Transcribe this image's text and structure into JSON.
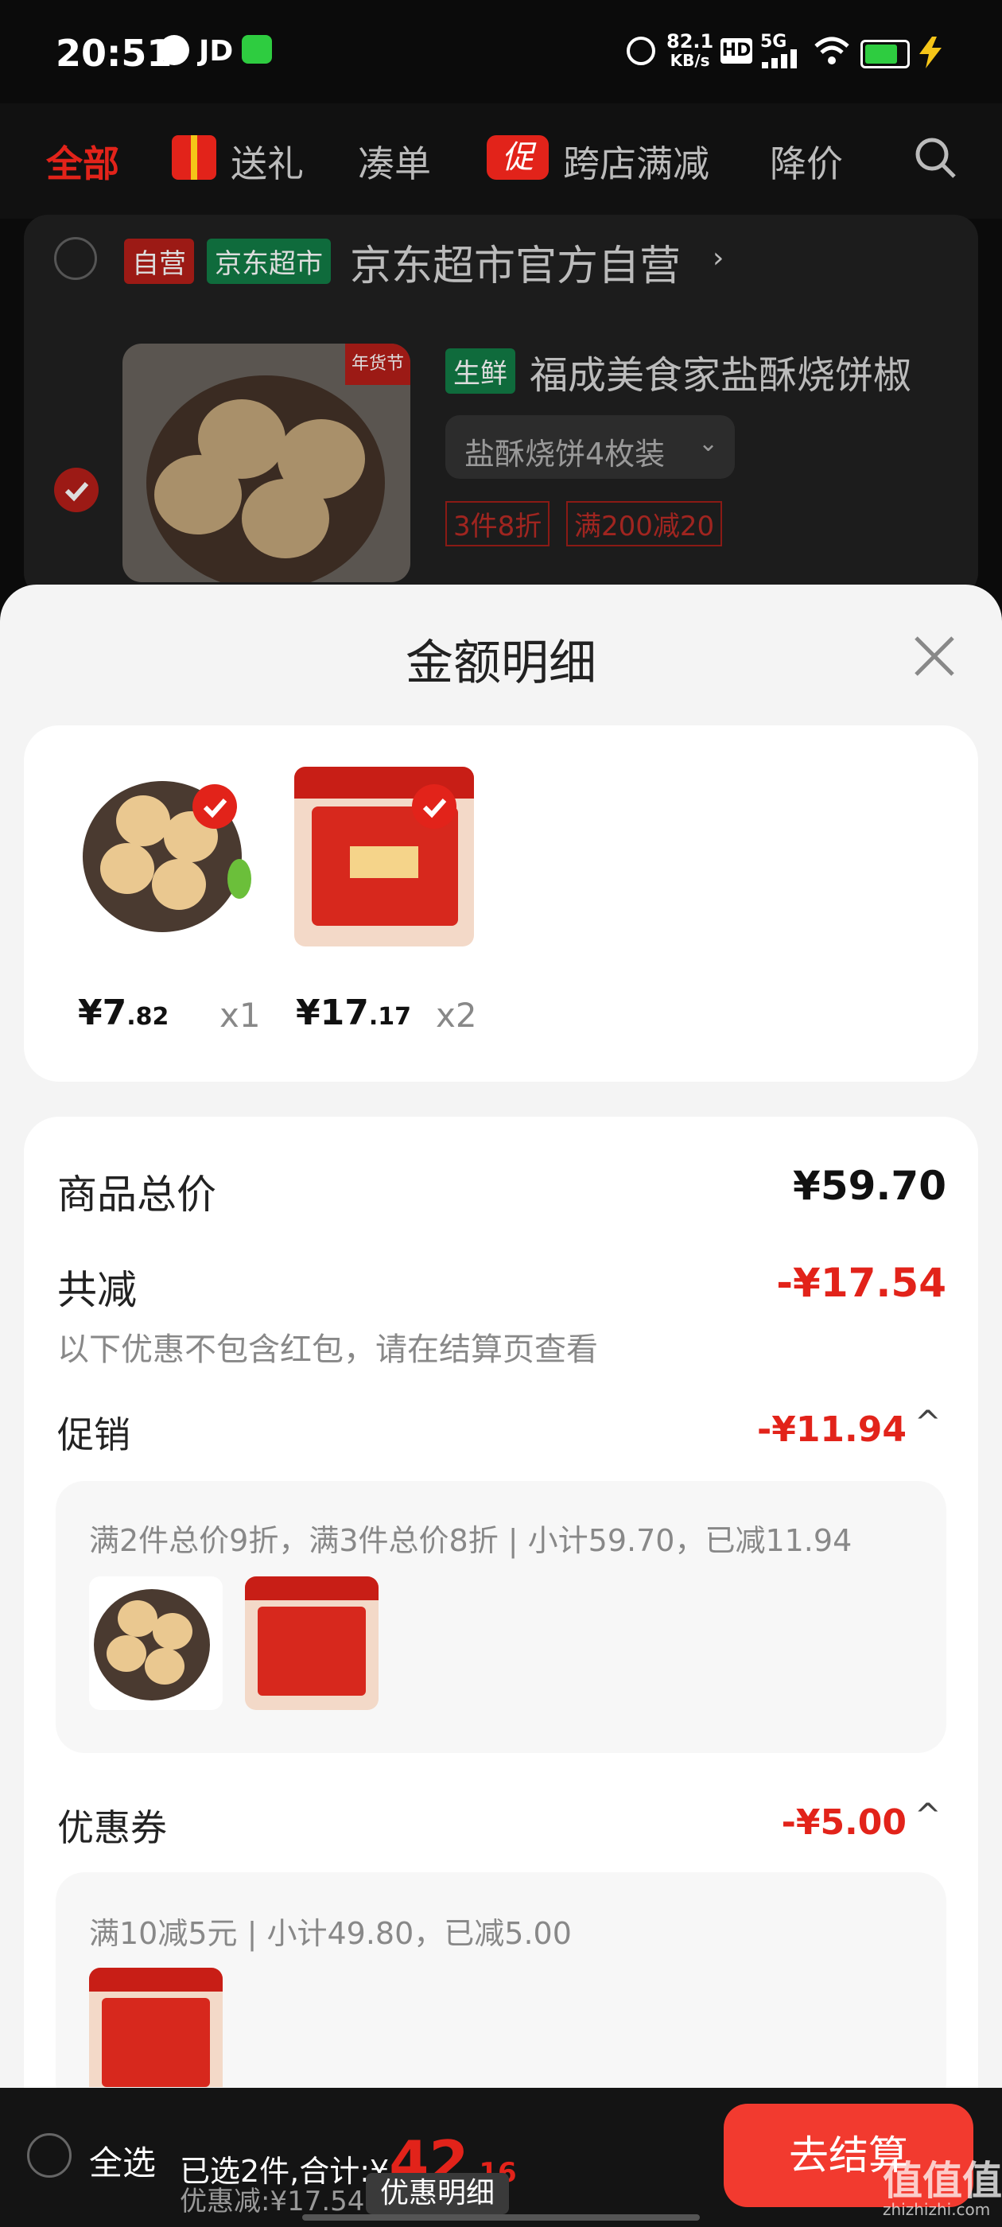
{
  "status_bar": {
    "time": "20:51",
    "carrier": "JD",
    "net_speed": "82.1",
    "net_unit": "KB/s",
    "hd": "HD",
    "signal": "5G"
  },
  "tabs": [
    {
      "label": "全部"
    },
    {
      "label": "送礼"
    },
    {
      "label": "凑单"
    },
    {
      "label": "跨店满减"
    },
    {
      "label": "降价"
    }
  ],
  "promo_tag": "促",
  "store": {
    "badge_self": "自营",
    "badge_market": "京东超市",
    "name": "京东超市官方自营",
    "item": {
      "tag": "生鲜",
      "title": "福成美食家盐酥烧饼椒",
      "spec": "盐酥烧饼4枚装",
      "promo1": "3件8折",
      "promo2": "满200减20",
      "thumb_label": "年货节"
    }
  },
  "sheet": {
    "title": "金额明细",
    "items": [
      {
        "price_int": "¥7",
        "price_dec": ".82",
        "qty": "x1"
      },
      {
        "price_int": "¥17",
        "price_dec": ".17",
        "qty": "x2"
      }
    ],
    "total_label": "商品总价",
    "total_value": "¥59.70",
    "reduce_label": "共减",
    "reduce_value": "-¥17.54",
    "reduce_note": "以下优惠不包含红包，请在结算页查看",
    "promo_label": "促销",
    "promo_value": "-¥11.94",
    "promo_detail": "满2件总价9折，满3件总价8折 | 小计59.70，已减11.94",
    "coupon_label": "优惠券",
    "coupon_value": "-¥5.00",
    "coupon_detail": "满10减5元 | 小计49.80，已减5.00"
  },
  "bottom": {
    "select_all": "全选",
    "summary_prefix": "已选2件,合计:¥",
    "total_int": "42",
    "total_dec": ".16",
    "discount": "优惠减:¥17.54",
    "detail_button": "优惠明细",
    "checkout": "去结算"
  },
  "watermark": "值值值",
  "watermark_url": "zhizhizhi.com",
  "colors": {
    "accent": "#e2231a",
    "market_green": "#19a05a"
  }
}
